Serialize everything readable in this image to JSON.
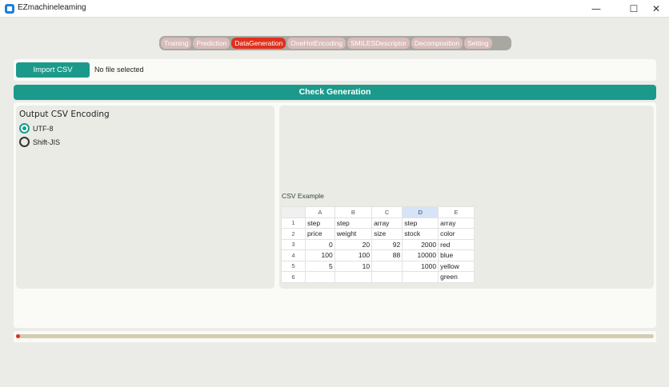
{
  "window": {
    "title": "EZmachineleaming",
    "minimize": "—",
    "maximize": "☐",
    "close": "✕"
  },
  "tabs": [
    {
      "label": "Training"
    },
    {
      "label": "Prediction"
    },
    {
      "label": "DataGeneration",
      "selected": true
    },
    {
      "label": "OneHotEncoding"
    },
    {
      "label": "SMILESDescriptor"
    },
    {
      "label": "Decomposition"
    },
    {
      "label": "Setting"
    }
  ],
  "import": {
    "button": "Import CSV",
    "status": "No file selected"
  },
  "check_button": "Check Generation",
  "encoding": {
    "title": "Output CSV Encoding",
    "options": [
      {
        "label": "UTF-8",
        "selected": true
      },
      {
        "label": "Shift-JIS",
        "selected": false
      }
    ]
  },
  "csv_example": {
    "label": "CSV Example",
    "columns": [
      "A",
      "B",
      "C",
      "D",
      "E"
    ],
    "selected_column": "D",
    "rows": [
      [
        "1",
        "step",
        "step",
        "array",
        "step",
        "array"
      ],
      [
        "2",
        "price",
        "weight",
        "size",
        "stock",
        "color"
      ],
      [
        "3",
        "0",
        "20",
        "92",
        "2000",
        "red"
      ],
      [
        "4",
        "100",
        "100",
        "88",
        "10000",
        "blue"
      ],
      [
        "5",
        "5",
        "10",
        "",
        "1000",
        "yellow"
      ],
      [
        "6",
        "",
        "",
        "",
        "",
        "green"
      ]
    ]
  },
  "progress": {
    "value": 0
  },
  "colors": {
    "accent": "#1b9a8b",
    "tab_selected": "#e0301e",
    "progress_track": "#d3ccb0"
  }
}
